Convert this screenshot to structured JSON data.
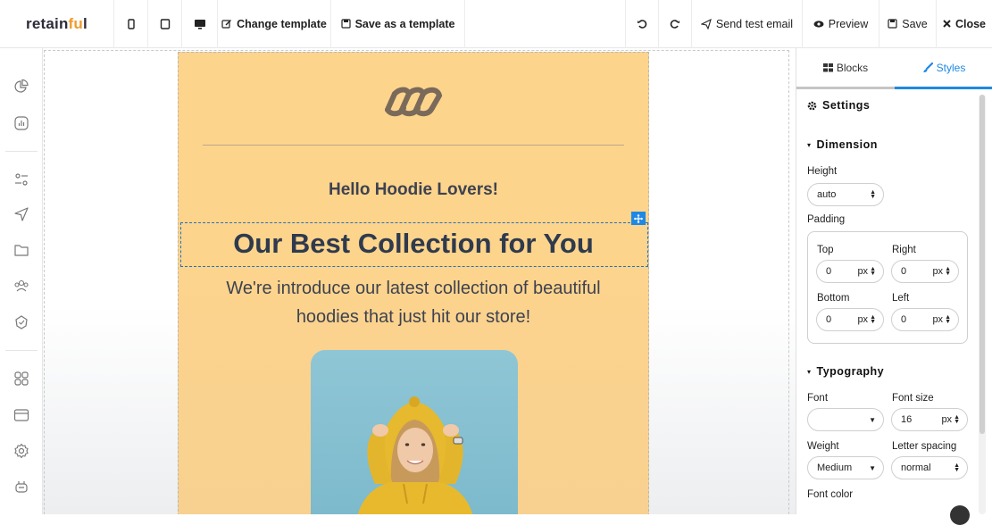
{
  "brand": {
    "name_a": "retain",
    "name_b": "fu",
    "name_c": "l"
  },
  "toolbar": {
    "change_template": "Change template",
    "save_as_template": "Save as a template",
    "send_test_email": "Send test email",
    "preview": "Preview",
    "save": "Save",
    "close": "Close"
  },
  "email": {
    "greeting": "Hello Hoodie Lovers!",
    "headline": "Our Best Collection for You",
    "subtext_line1": "We're introduce our latest collection of beautiful",
    "subtext_line2": "hoodies that just hit our store!"
  },
  "panel": {
    "tabs": [
      {
        "label": "Blocks"
      },
      {
        "label": "Styles"
      }
    ],
    "settings_title": "Settings",
    "dimension": {
      "title": "Dimension",
      "height_label": "Height",
      "height_value": "auto",
      "padding_label": "Padding",
      "top_label": "Top",
      "top_value": "0",
      "right_label": "Right",
      "right_value": "0",
      "bottom_label": "Bottom",
      "bottom_value": "0",
      "left_label": "Left",
      "left_value": "0",
      "unit": "px"
    },
    "typography": {
      "title": "Typography",
      "font_label": "Font",
      "font_value": "",
      "font_size_label": "Font size",
      "font_size_value": "16",
      "weight_label": "Weight",
      "weight_value": "Medium",
      "letter_spacing_label": "Letter spacing",
      "letter_spacing_value": "normal",
      "font_color_label": "Font color",
      "unit": "px"
    }
  },
  "colors": {
    "accent": "#1e88e5",
    "email_bg": "#fdd48c",
    "brand_orange": "#f09a2c"
  }
}
